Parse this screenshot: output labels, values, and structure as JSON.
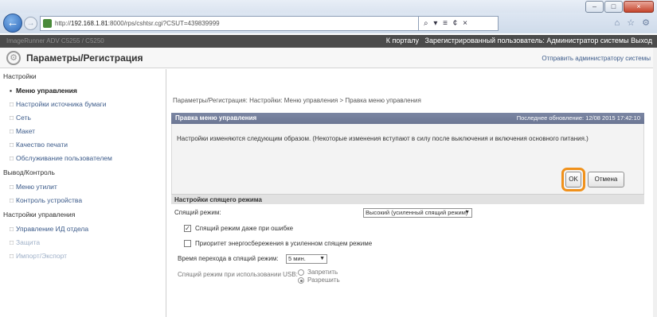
{
  "browser": {
    "url_host": "192.168.1.81",
    "url_rest": ":8000/rps/cshtsr.cgi?CSUT=439839999",
    "url_prefix": "http://",
    "address_tools": "⌕ ▾ ≡ ¢ ×",
    "right_icons": "⌂ ☆ ⚙",
    "window_buttons": [
      "–",
      "□",
      "×"
    ]
  },
  "ui_header": {
    "model": "ImageRunner ADV C5255 / C5250",
    "portal_link": "К порталу",
    "user_text": "Зарегистрированный пользователь: Администратор системы",
    "logout": "Выход"
  },
  "page": {
    "title": "Параметры/Регистрация",
    "send_admin": "Отправить администратору системы"
  },
  "sidebar": {
    "sections": [
      "Настройки",
      "Вывод/Контроль",
      "Настройки управления"
    ],
    "items": [
      "Меню управления",
      "Настройки источника бумаги",
      "Сеть",
      "Макет",
      "Качество печати",
      "Обслуживание пользователем",
      "Меню утилит",
      "Контроль устройства",
      "Управление ИД отдела",
      "Защита",
      "Импорт/Экспорт"
    ]
  },
  "main": {
    "breadcrumb": "Параметры/Регистрация: Настройки: Меню управления > Правка меню управления",
    "panel_title": "Правка меню управления",
    "last_updated": "Последнее обновление: 12/08 2015 17:42:10",
    "message": "Настройки изменяются следующим образом. (Некоторые изменения вступают в силу после выключения и включения основного питания.)",
    "ok_label": "OK",
    "cancel_label": "Отмена",
    "section_title": "Настройки спящего режима",
    "sleep_mode_label": "Спящий режим:",
    "sleep_mode_value": "Высокий (усиленный спящий режим)",
    "cb_error_label": "Спящий режим даже при ошибке",
    "cb_error_checked": true,
    "cb_priority_label": "Приоритет энергосбережения в усиленном спящем режиме",
    "cb_priority_checked": false,
    "transition_label": "Время перехода в спящий режим:",
    "transition_value": "5 мин.",
    "usb_label": "Спящий режим при использовании USB:",
    "usb_option_forbid": "Запретить",
    "usb_option_allow": "Разрешить",
    "usb_selected": "Разрешить"
  },
  "colors": {
    "header_dark": "#4b4b4b",
    "panel_head": "#717c99",
    "link": "#3c5b8a",
    "ok_highlight": "#f0911b"
  }
}
